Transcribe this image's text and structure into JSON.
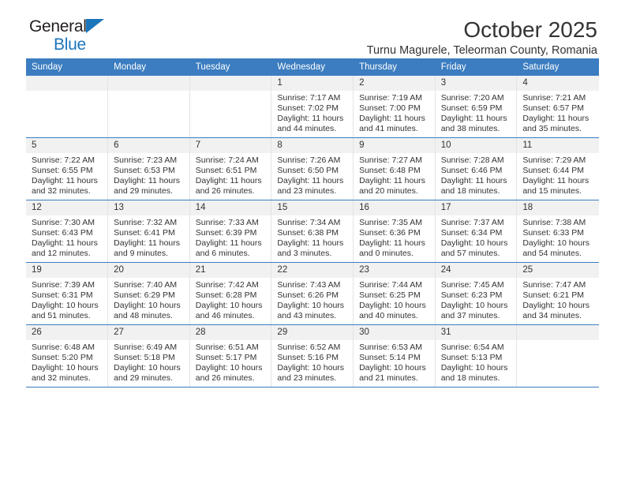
{
  "brand": {
    "name_part1": "General",
    "name_part2": "Blue",
    "accent_color": "#1b75bb"
  },
  "header": {
    "title": "October 2025",
    "subtitle": "Turnu Magurele, Teleorman County, Romania"
  },
  "calendar": {
    "header_bg": "#3b7dc0",
    "daynum_bg": "#f1f1f1",
    "weekday_headers": [
      "Sunday",
      "Monday",
      "Tuesday",
      "Wednesday",
      "Thursday",
      "Friday",
      "Saturday"
    ],
    "weeks": [
      [
        {
          "day": "",
          "sunrise": "",
          "sunset": "",
          "daylight1": "",
          "daylight2": "",
          "empty": true
        },
        {
          "day": "",
          "sunrise": "",
          "sunset": "",
          "daylight1": "",
          "daylight2": "",
          "empty": true
        },
        {
          "day": "",
          "sunrise": "",
          "sunset": "",
          "daylight1": "",
          "daylight2": "",
          "empty": true
        },
        {
          "day": "1",
          "sunrise": "Sunrise: 7:17 AM",
          "sunset": "Sunset: 7:02 PM",
          "daylight1": "Daylight: 11 hours",
          "daylight2": "and 44 minutes."
        },
        {
          "day": "2",
          "sunrise": "Sunrise: 7:19 AM",
          "sunset": "Sunset: 7:00 PM",
          "daylight1": "Daylight: 11 hours",
          "daylight2": "and 41 minutes."
        },
        {
          "day": "3",
          "sunrise": "Sunrise: 7:20 AM",
          "sunset": "Sunset: 6:59 PM",
          "daylight1": "Daylight: 11 hours",
          "daylight2": "and 38 minutes."
        },
        {
          "day": "4",
          "sunrise": "Sunrise: 7:21 AM",
          "sunset": "Sunset: 6:57 PM",
          "daylight1": "Daylight: 11 hours",
          "daylight2": "and 35 minutes."
        }
      ],
      [
        {
          "day": "5",
          "sunrise": "Sunrise: 7:22 AM",
          "sunset": "Sunset: 6:55 PM",
          "daylight1": "Daylight: 11 hours",
          "daylight2": "and 32 minutes."
        },
        {
          "day": "6",
          "sunrise": "Sunrise: 7:23 AM",
          "sunset": "Sunset: 6:53 PM",
          "daylight1": "Daylight: 11 hours",
          "daylight2": "and 29 minutes."
        },
        {
          "day": "7",
          "sunrise": "Sunrise: 7:24 AM",
          "sunset": "Sunset: 6:51 PM",
          "daylight1": "Daylight: 11 hours",
          "daylight2": "and 26 minutes."
        },
        {
          "day": "8",
          "sunrise": "Sunrise: 7:26 AM",
          "sunset": "Sunset: 6:50 PM",
          "daylight1": "Daylight: 11 hours",
          "daylight2": "and 23 minutes."
        },
        {
          "day": "9",
          "sunrise": "Sunrise: 7:27 AM",
          "sunset": "Sunset: 6:48 PM",
          "daylight1": "Daylight: 11 hours",
          "daylight2": "and 20 minutes."
        },
        {
          "day": "10",
          "sunrise": "Sunrise: 7:28 AM",
          "sunset": "Sunset: 6:46 PM",
          "daylight1": "Daylight: 11 hours",
          "daylight2": "and 18 minutes."
        },
        {
          "day": "11",
          "sunrise": "Sunrise: 7:29 AM",
          "sunset": "Sunset: 6:44 PM",
          "daylight1": "Daylight: 11 hours",
          "daylight2": "and 15 minutes."
        }
      ],
      [
        {
          "day": "12",
          "sunrise": "Sunrise: 7:30 AM",
          "sunset": "Sunset: 6:43 PM",
          "daylight1": "Daylight: 11 hours",
          "daylight2": "and 12 minutes."
        },
        {
          "day": "13",
          "sunrise": "Sunrise: 7:32 AM",
          "sunset": "Sunset: 6:41 PM",
          "daylight1": "Daylight: 11 hours",
          "daylight2": "and 9 minutes."
        },
        {
          "day": "14",
          "sunrise": "Sunrise: 7:33 AM",
          "sunset": "Sunset: 6:39 PM",
          "daylight1": "Daylight: 11 hours",
          "daylight2": "and 6 minutes."
        },
        {
          "day": "15",
          "sunrise": "Sunrise: 7:34 AM",
          "sunset": "Sunset: 6:38 PM",
          "daylight1": "Daylight: 11 hours",
          "daylight2": "and 3 minutes."
        },
        {
          "day": "16",
          "sunrise": "Sunrise: 7:35 AM",
          "sunset": "Sunset: 6:36 PM",
          "daylight1": "Daylight: 11 hours",
          "daylight2": "and 0 minutes."
        },
        {
          "day": "17",
          "sunrise": "Sunrise: 7:37 AM",
          "sunset": "Sunset: 6:34 PM",
          "daylight1": "Daylight: 10 hours",
          "daylight2": "and 57 minutes."
        },
        {
          "day": "18",
          "sunrise": "Sunrise: 7:38 AM",
          "sunset": "Sunset: 6:33 PM",
          "daylight1": "Daylight: 10 hours",
          "daylight2": "and 54 minutes."
        }
      ],
      [
        {
          "day": "19",
          "sunrise": "Sunrise: 7:39 AM",
          "sunset": "Sunset: 6:31 PM",
          "daylight1": "Daylight: 10 hours",
          "daylight2": "and 51 minutes."
        },
        {
          "day": "20",
          "sunrise": "Sunrise: 7:40 AM",
          "sunset": "Sunset: 6:29 PM",
          "daylight1": "Daylight: 10 hours",
          "daylight2": "and 48 minutes."
        },
        {
          "day": "21",
          "sunrise": "Sunrise: 7:42 AM",
          "sunset": "Sunset: 6:28 PM",
          "daylight1": "Daylight: 10 hours",
          "daylight2": "and 46 minutes."
        },
        {
          "day": "22",
          "sunrise": "Sunrise: 7:43 AM",
          "sunset": "Sunset: 6:26 PM",
          "daylight1": "Daylight: 10 hours",
          "daylight2": "and 43 minutes."
        },
        {
          "day": "23",
          "sunrise": "Sunrise: 7:44 AM",
          "sunset": "Sunset: 6:25 PM",
          "daylight1": "Daylight: 10 hours",
          "daylight2": "and 40 minutes."
        },
        {
          "day": "24",
          "sunrise": "Sunrise: 7:45 AM",
          "sunset": "Sunset: 6:23 PM",
          "daylight1": "Daylight: 10 hours",
          "daylight2": "and 37 minutes."
        },
        {
          "day": "25",
          "sunrise": "Sunrise: 7:47 AM",
          "sunset": "Sunset: 6:21 PM",
          "daylight1": "Daylight: 10 hours",
          "daylight2": "and 34 minutes."
        }
      ],
      [
        {
          "day": "26",
          "sunrise": "Sunrise: 6:48 AM",
          "sunset": "Sunset: 5:20 PM",
          "daylight1": "Daylight: 10 hours",
          "daylight2": "and 32 minutes."
        },
        {
          "day": "27",
          "sunrise": "Sunrise: 6:49 AM",
          "sunset": "Sunset: 5:18 PM",
          "daylight1": "Daylight: 10 hours",
          "daylight2": "and 29 minutes."
        },
        {
          "day": "28",
          "sunrise": "Sunrise: 6:51 AM",
          "sunset": "Sunset: 5:17 PM",
          "daylight1": "Daylight: 10 hours",
          "daylight2": "and 26 minutes."
        },
        {
          "day": "29",
          "sunrise": "Sunrise: 6:52 AM",
          "sunset": "Sunset: 5:16 PM",
          "daylight1": "Daylight: 10 hours",
          "daylight2": "and 23 minutes."
        },
        {
          "day": "30",
          "sunrise": "Sunrise: 6:53 AM",
          "sunset": "Sunset: 5:14 PM",
          "daylight1": "Daylight: 10 hours",
          "daylight2": "and 21 minutes."
        },
        {
          "day": "31",
          "sunrise": "Sunrise: 6:54 AM",
          "sunset": "Sunset: 5:13 PM",
          "daylight1": "Daylight: 10 hours",
          "daylight2": "and 18 minutes."
        },
        {
          "day": "",
          "sunrise": "",
          "sunset": "",
          "daylight1": "",
          "daylight2": "",
          "empty": true
        }
      ]
    ]
  }
}
